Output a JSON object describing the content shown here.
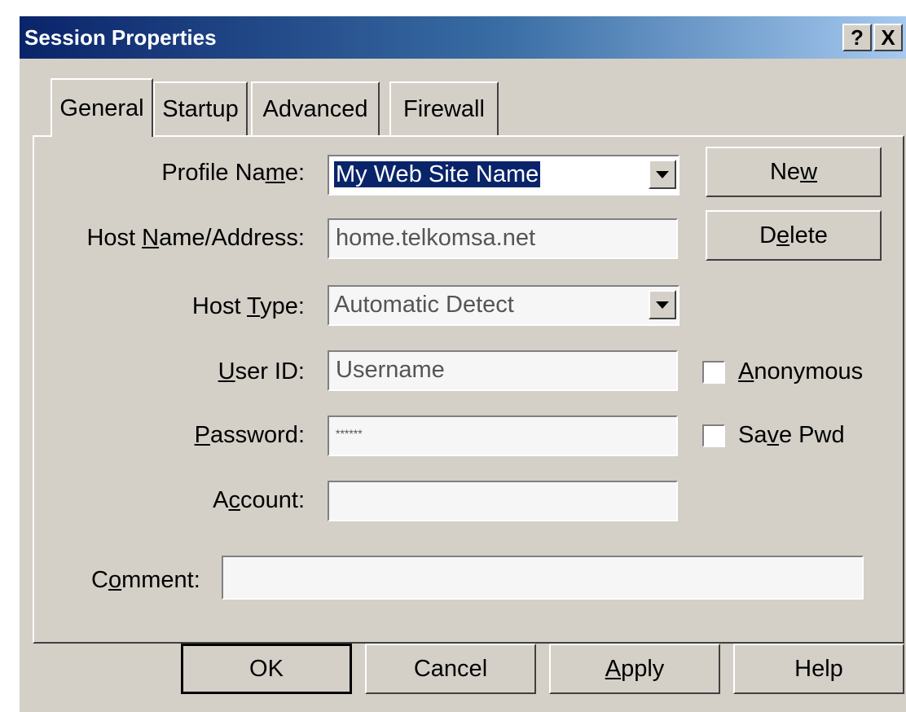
{
  "window": {
    "title": "Session Properties",
    "help_glyph": "?",
    "close_glyph": "X"
  },
  "tabs": [
    {
      "label": "General",
      "active": true
    },
    {
      "label": "Startup",
      "active": false
    },
    {
      "label": "Advanced",
      "active": false
    },
    {
      "label": "Firewall",
      "active": false
    }
  ],
  "form": {
    "profile_name": {
      "label_pre": "Profile Na",
      "label_key": "m",
      "label_post": "e:",
      "value": "My Web Site Name"
    },
    "host_name": {
      "label_pre": "Host ",
      "label_key": "N",
      "label_post": "ame/Address:",
      "value": "home.telkomsa.net"
    },
    "host_type": {
      "label_pre": "Host ",
      "label_key": "T",
      "label_post": "ype:",
      "value": "Automatic Detect"
    },
    "user_id": {
      "label_pre": "",
      "label_key": "U",
      "label_post": "ser ID:",
      "value": "Username"
    },
    "password": {
      "label_pre": "",
      "label_key": "P",
      "label_post": "assword:",
      "value": "******"
    },
    "account": {
      "label_pre": "A",
      "label_key": "c",
      "label_post": "count:",
      "value": ""
    },
    "comment": {
      "label_pre": "C",
      "label_key": "o",
      "label_post": "mment:",
      "value": ""
    }
  },
  "side_buttons": {
    "new": {
      "pre": "Ne",
      "key": "w",
      "post": ""
    },
    "delete": {
      "pre": "D",
      "key": "e",
      "post": "lete"
    }
  },
  "checkboxes": {
    "anonymous": {
      "pre": "",
      "key": "A",
      "post": "nonymous",
      "checked": false
    },
    "save_pwd": {
      "pre": "Sa",
      "key": "v",
      "post": "e Pwd",
      "checked": false
    }
  },
  "footer": {
    "ok": "OK",
    "cancel": "Cancel",
    "apply": {
      "pre": "",
      "key": "A",
      "post": "pply"
    },
    "help": "Help"
  },
  "colors": {
    "title_gradient_start": "#0a246a",
    "title_gradient_end": "#a6caf0",
    "face": "#d4d0c8",
    "selection": "#0a246a"
  }
}
